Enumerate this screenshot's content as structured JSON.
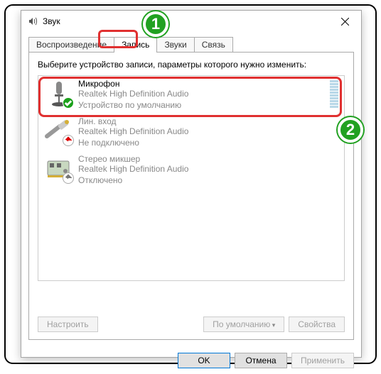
{
  "window": {
    "title": "Звук",
    "icon": "speaker-icon"
  },
  "tabs": [
    {
      "label": "Воспроизведение"
    },
    {
      "label": "Запись",
      "active": true
    },
    {
      "label": "Звуки"
    },
    {
      "label": "Связь"
    }
  ],
  "instruction": "Выберите устройство записи, параметры которого нужно изменить:",
  "devices": [
    {
      "name": "Микрофон",
      "driver": "Realtek High Definition Audio",
      "status": "Устройство по умолчанию",
      "badge": "default-check",
      "enabled": true
    },
    {
      "name": "Лин. вход",
      "driver": "Realtek High Definition Audio",
      "status": "Не подключено",
      "badge": "unplugged",
      "enabled": false
    },
    {
      "name": "Стерео микшер",
      "driver": "Realtek High Definition Audio",
      "status": "Отключено",
      "badge": "disabled",
      "enabled": false
    }
  ],
  "buttons": {
    "configure": "Настроить",
    "set_default": "По умолчанию",
    "properties": "Свойства",
    "ok": "OK",
    "cancel": "Отмена",
    "apply": "Применить"
  },
  "annotations": {
    "step1": "1",
    "step2": "2"
  }
}
